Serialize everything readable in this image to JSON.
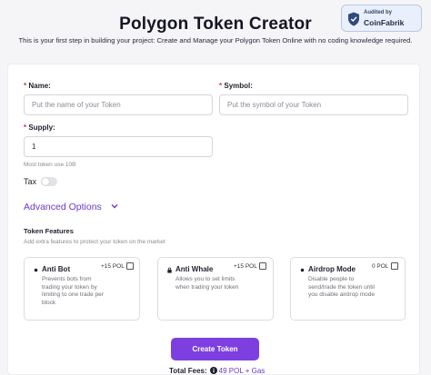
{
  "header": {
    "title": "Polygon Token Creator",
    "subtitle": "This is your first step in building your project: Create and Manage your Polygon Token Online with no coding knowledge required."
  },
  "audit_badge": {
    "top_text": "Audited by",
    "name": "CoinFabrik"
  },
  "form": {
    "name": {
      "label": "Name:",
      "required_mark": "*",
      "placeholder": "Put the name of your Token",
      "value": ""
    },
    "symbol": {
      "label": "Symbol:",
      "required_mark": "*",
      "placeholder": "Put the symbol of your Token",
      "value": ""
    },
    "supply": {
      "label": "Supply:",
      "required_mark": "*",
      "value": "1",
      "hint": "Most token use 10B"
    },
    "tax": {
      "label": "Tax",
      "enabled": false
    },
    "advanced_options_label": "Advanced Options"
  },
  "features": {
    "title": "Token Features",
    "hint": "Add extra features to protect your token on the market",
    "items": [
      {
        "icon": "dot-icon",
        "name": "Anti Bot",
        "price": "+15 POL",
        "checked": false,
        "desc_lines": [
          "Prevents bots from",
          "trading your token by",
          "limiting to one trade per",
          "block"
        ]
      },
      {
        "icon": "lock-icon",
        "name": "Anti Whale",
        "price": "+15 POL",
        "checked": false,
        "desc_lines": [
          "Allows you to set limits",
          "when trading your token"
        ]
      },
      {
        "icon": "dot-icon",
        "name": "Airdrop Mode",
        "price": "0 POL",
        "checked": false,
        "desc_lines": [
          "Disable people to",
          "send/trade the token until",
          "you disable airdrop mode"
        ]
      }
    ]
  },
  "create_button_label": "Create Token",
  "fees": {
    "label": "Total Fees:",
    "amount": "49 POL + Gas"
  },
  "colors": {
    "accent": "#7d3fe0",
    "accent_text": "#6a38c9",
    "required": "#e0303c",
    "background": "#f5f5f7"
  }
}
